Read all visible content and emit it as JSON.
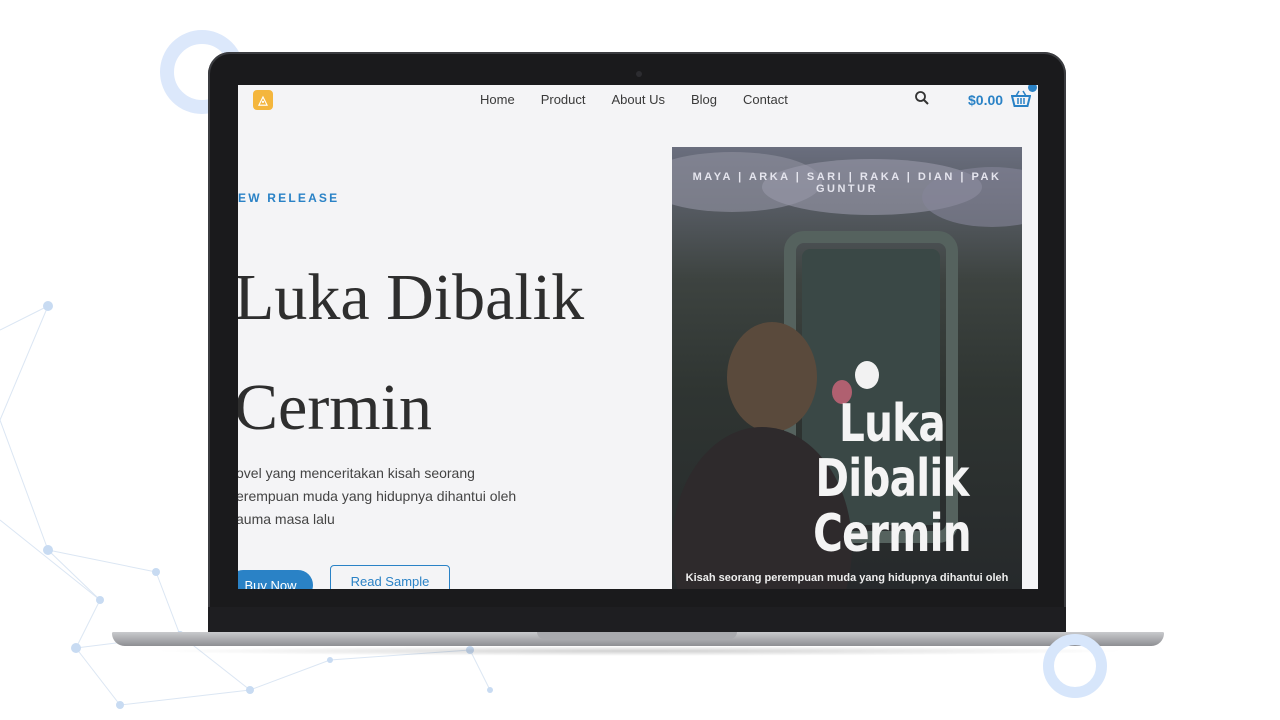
{
  "nav": {
    "links": [
      "Home",
      "Product",
      "About Us",
      "Blog",
      "Contact"
    ],
    "cart_total": "$0.00"
  },
  "hero": {
    "eyebrow": "EW RELEASE",
    "title_line1": "Luka Dibalik",
    "title_line2": "Cermin",
    "description_line1": "ovel yang menceritakan kisah seorang",
    "description_line2": "erempuan muda yang hidupnya dihantui oleh",
    "description_line3": "auma masa lalu",
    "buy_label": "Buy Now",
    "sample_label": "Read Sample"
  },
  "cover": {
    "authors": "MAYA | ARKA | SARI | RAKA | DIAN | PAK GUNTUR",
    "title_line1": "Luka",
    "title_line2": "Dibalik",
    "title_line3": "Cermin",
    "tagline": "Kisah seorang perempuan muda yang hidupnya dihantui oleh"
  },
  "colors": {
    "accent": "#2a82c6",
    "page_bg": "#f4f4f6"
  }
}
